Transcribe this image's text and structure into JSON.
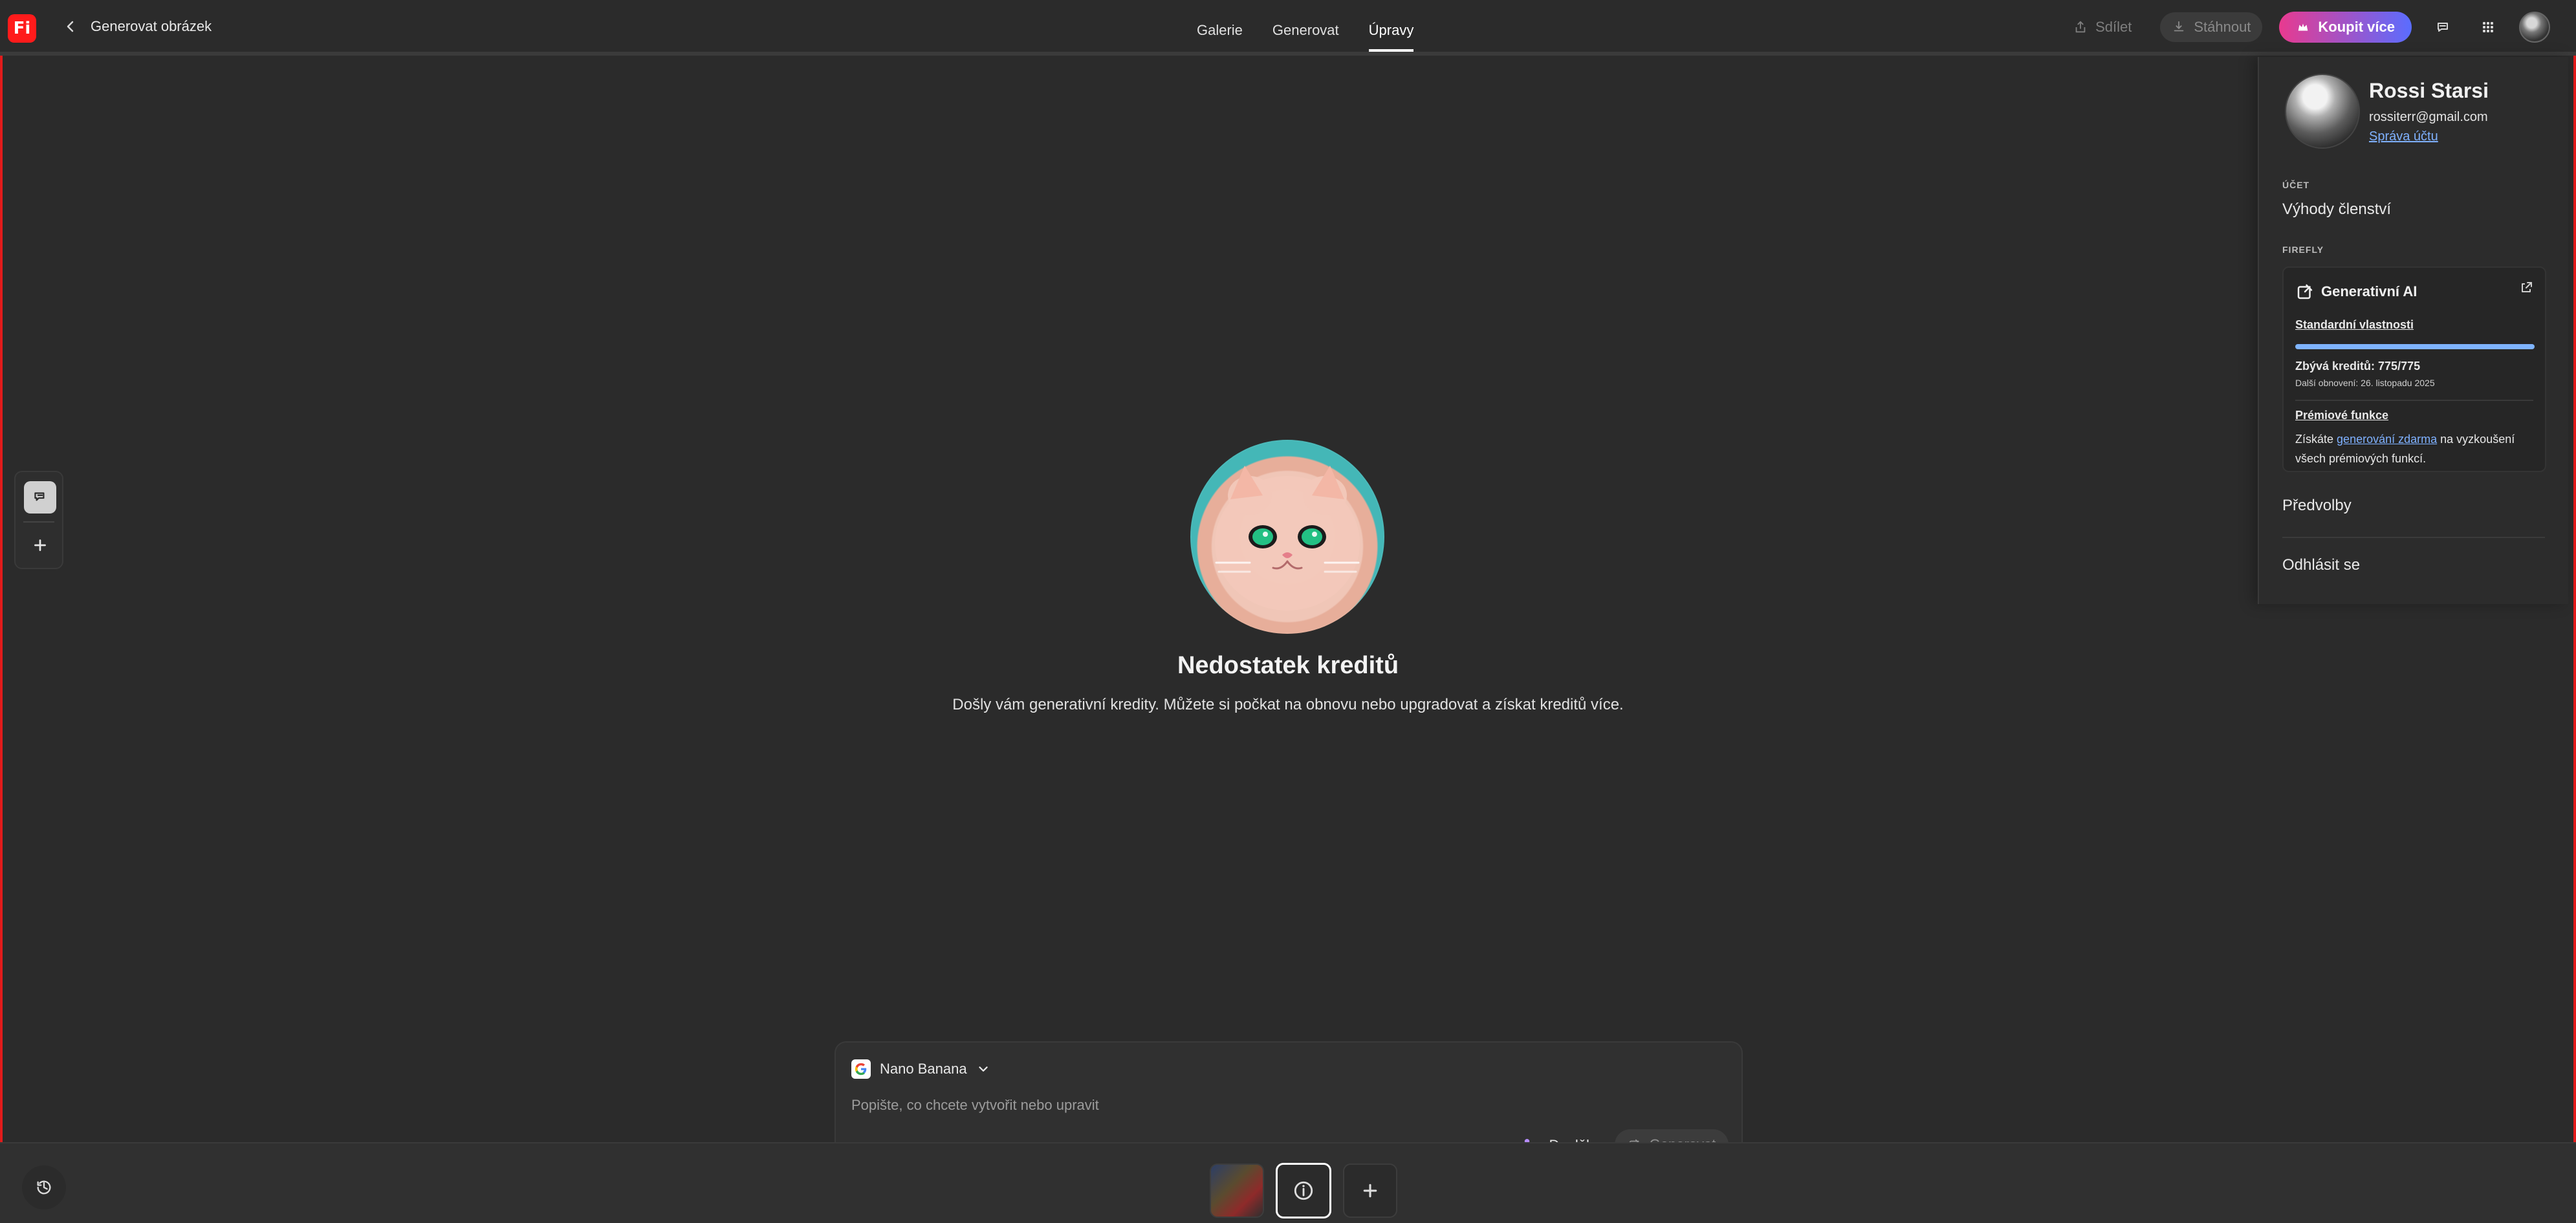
{
  "app": {
    "badge": "Fi",
    "title": "Generovat obrázek"
  },
  "nav": {
    "tabs": [
      {
        "label": "Galerie",
        "active": false
      },
      {
        "label": "Generovat",
        "active": false
      },
      {
        "label": "Úpravy",
        "active": true
      }
    ]
  },
  "actions": {
    "share_label": "Sdílet",
    "download_label": "Stáhnout",
    "buy_label": "Koupit více"
  },
  "main": {
    "title": "Nedostatek kreditů",
    "subtitle": "Došly vám generativní kredity. Můžete si počkat na obnovu nebo upgradovat a získat kreditů více."
  },
  "prompt": {
    "model_label": "Nano Banana",
    "placeholder": "Popište, co chcete vytvořit nebo upravit",
    "addons_label": "Doplňky",
    "generate_label": "Generovat"
  },
  "account": {
    "name": "Rossi Starsi",
    "email": "rossiterr@gmail.com",
    "manage_label": "Správa účtu",
    "section_account": "ÚČET",
    "membership_label": "Výhody členství",
    "section_firefly": "FIREFLY",
    "genai": {
      "title": "Generativní AI",
      "standard_label": "Standardní vlastnosti",
      "credits_label": "Zbývá kreditů: 775/775",
      "credits_fraction": 1.0,
      "renew_label": "Další obnovení: 26. listopadu 2025",
      "premium_label": "Prémiové funkce",
      "premium_text_prefix": "Získáte",
      "premium_text_link": "generování zdarma",
      "premium_text_suffix": "na vyzkoušení všech prémiových funkcí."
    },
    "preferences_label": "Předvolby",
    "logout_label": "Odhlásit se"
  },
  "colors": {
    "accent_pink": "#e83a8f",
    "accent_blue": "#5a6dff",
    "link": "#7fb1ff",
    "frame_red": "#e11b1b"
  }
}
